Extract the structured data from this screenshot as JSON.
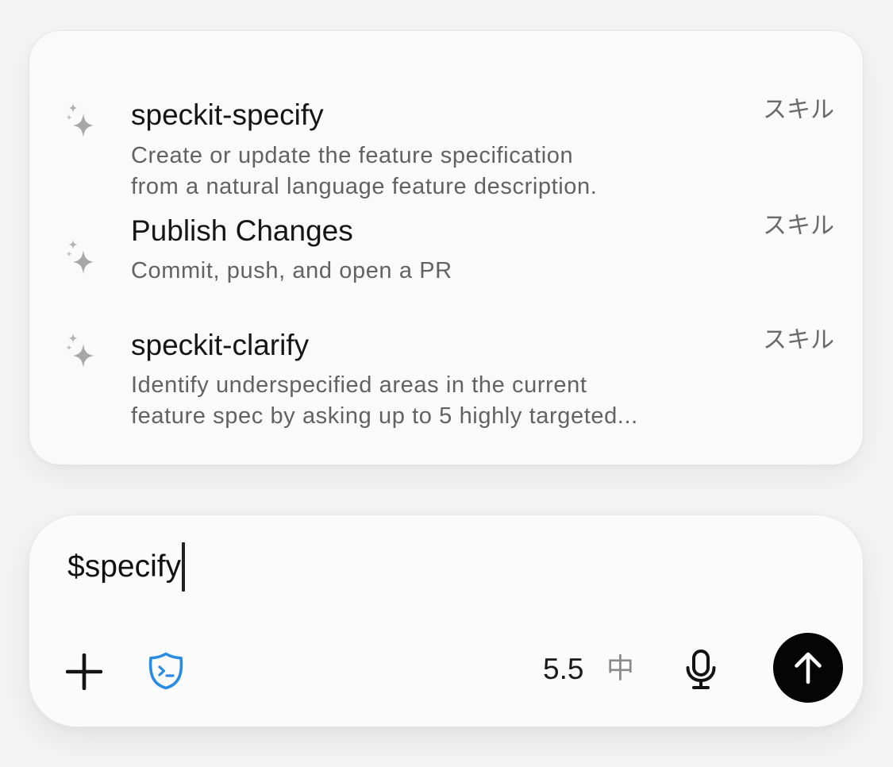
{
  "suggestions": [
    {
      "icon": "sparkles-icon",
      "title": "speckit-specify",
      "description_line1": "Create or update the feature specification",
      "description_line2": "from a natural language feature description.",
      "tag": "スキル"
    },
    {
      "icon": "sparkles-icon",
      "title": "Publish Changes",
      "description_line1": "Commit, push, and open a PR",
      "tag": "スキル"
    },
    {
      "icon": "sparkles-icon",
      "title": "speckit-clarify",
      "description_line1": "Identify underspecified areas in the current",
      "description_line2": "feature spec by asking up to 5 highly targeted...",
      "tag": "スキル"
    }
  ],
  "composer": {
    "input_value": "$specify",
    "model": "5.5",
    "effort": "中",
    "icons": {
      "add": "plus-icon",
      "sandbox": "terminal-shield-icon",
      "mic": "microphone-icon",
      "send": "arrow-up-icon"
    }
  },
  "colors": {
    "background": "#f4f4f4",
    "panel": "#fafafa",
    "accent_blue": "#2a8be5",
    "send_button": "#050505"
  }
}
